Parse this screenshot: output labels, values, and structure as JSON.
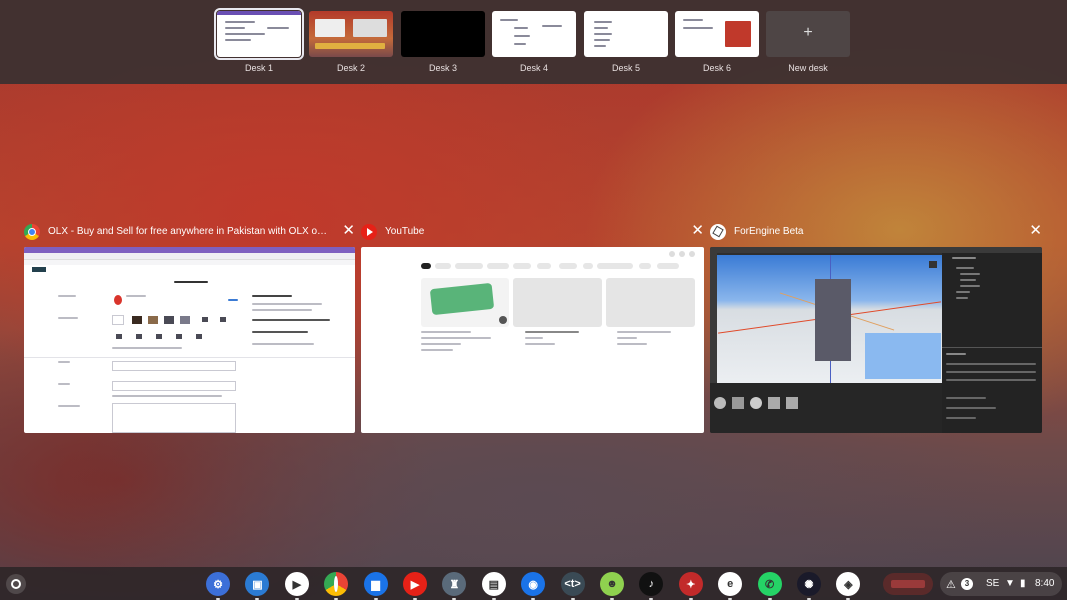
{
  "desks": [
    {
      "label": "Desk 1",
      "active": true
    },
    {
      "label": "Desk 2",
      "active": false
    },
    {
      "label": "Desk 3",
      "active": false
    },
    {
      "label": "Desk 4",
      "active": false
    },
    {
      "label": "Desk 5",
      "active": false
    },
    {
      "label": "Desk 6",
      "active": false
    }
  ],
  "new_desk": {
    "icon": "+",
    "label": "New desk"
  },
  "windows": [
    {
      "app": "chrome",
      "icon": "chrome-icon",
      "title": "OLX - Buy and Sell for free anywhere in Pakistan with OLX onl...",
      "close": "✕"
    },
    {
      "app": "youtube",
      "icon": "youtube-icon",
      "title": "YouTube",
      "close": "✕"
    },
    {
      "app": "forengine",
      "icon": "forengine-icon",
      "title": "ForEngine Beta",
      "close": "✕"
    }
  ],
  "shelf": {
    "apps": [
      {
        "name": "settings",
        "icon": "gear-icon",
        "glyph": "⚙",
        "color": "#3c6fd8"
      },
      {
        "name": "files-drive",
        "icon": "desktop-app-icon",
        "glyph": "▣",
        "color": "#2b7bd3"
      },
      {
        "name": "play-store",
        "icon": "play-store-icon",
        "glyph": "▶",
        "color": "#ffffff"
      },
      {
        "name": "chrome",
        "icon": "chrome-icon",
        "glyph": "",
        "color": "#ffffff"
      },
      {
        "name": "files",
        "icon": "folder-icon",
        "glyph": "▆",
        "color": "#1a73e8"
      },
      {
        "name": "youtube",
        "icon": "youtube-icon",
        "glyph": "▶",
        "color": "#e62117"
      },
      {
        "name": "game",
        "icon": "game-character-icon",
        "glyph": "♜",
        "color": "#5a6a7a"
      },
      {
        "name": "media",
        "icon": "media-icon",
        "glyph": "▤",
        "color": "#ffffff"
      },
      {
        "name": "camera",
        "icon": "camera-icon",
        "glyph": "◉",
        "color": "#1a73e8"
      },
      {
        "name": "terminal",
        "icon": "terminal-icon",
        "glyph": "<t>",
        "color": "#3a4a55"
      },
      {
        "name": "frog-game",
        "icon": "frog-icon",
        "glyph": "☻",
        "color": "#8fd14f"
      },
      {
        "name": "tiktok",
        "icon": "tiktok-icon",
        "glyph": "♪",
        "color": "#111111"
      },
      {
        "name": "spider-game",
        "icon": "hero-icon",
        "glyph": "✦",
        "color": "#c22a2a"
      },
      {
        "name": "e-app",
        "icon": "e-letter-icon",
        "glyph": "e",
        "color": "#ffffff"
      },
      {
        "name": "whatsapp",
        "icon": "whatsapp-icon",
        "glyph": "✆",
        "color": "#25d366"
      },
      {
        "name": "shadow-game",
        "icon": "shadow-game-icon",
        "glyph": "✺",
        "color": "#1a1a2a"
      },
      {
        "name": "forengine",
        "icon": "cube-icon",
        "glyph": "◈",
        "color": "#ffffff"
      }
    ]
  },
  "status": {
    "notification_count": "3",
    "keyboard_layout": "SE",
    "time": "8:40"
  }
}
